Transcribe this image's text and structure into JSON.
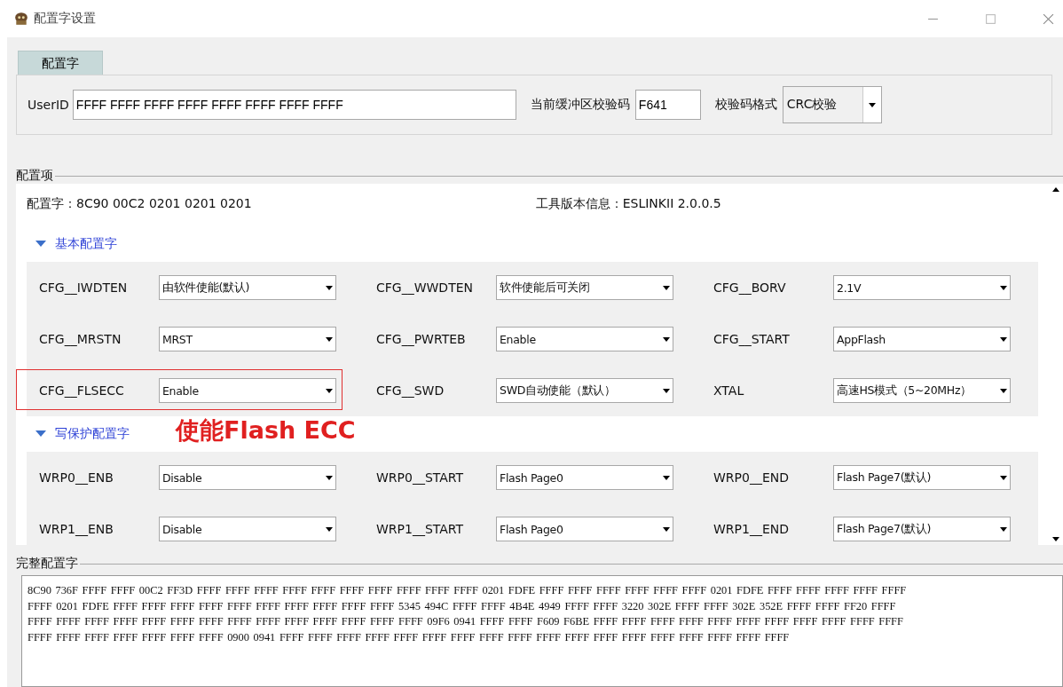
{
  "window": {
    "title": "配置字设置"
  },
  "tabs": [
    {
      "label": "配置字",
      "selected": true
    }
  ],
  "userid": {
    "label": "UserID",
    "value": "FFFF FFFF FFFF FFFF FFFF FFFF FFFF FFFF"
  },
  "checksum": {
    "label": "当前缓冲区校验码",
    "value": "F641"
  },
  "checksum_format": {
    "label": "校验码格式",
    "value": "CRC校验"
  },
  "config_group": {
    "title": "配置项",
    "config_word": "配置字：8C90 00C2 0201 0201 0201",
    "tool_version": "工具版本信息：ESLINKII 2.0.0.5",
    "sections": [
      {
        "title": "基本配置字",
        "expanded": true,
        "fields": [
          {
            "label": "CFG__IWDTEN",
            "value": "由软件使能(默认)",
            "highlighted": false
          },
          {
            "label": "CFG__WWDTEN",
            "value": "软件使能后可关闭",
            "highlighted": false
          },
          {
            "label": "CFG__BORV",
            "value": "2.1V",
            "highlighted": false
          },
          {
            "label": "CFG__MRSTN",
            "value": "MRST",
            "highlighted": false
          },
          {
            "label": "CFG__PWRTEB",
            "value": "Enable",
            "highlighted": false
          },
          {
            "label": "CFG__START",
            "value": "AppFlash",
            "highlighted": false
          },
          {
            "label": "CFG__FLSECC",
            "value": "Enable",
            "highlighted": true
          },
          {
            "label": "CFG__SWD",
            "value": "SWD自动使能（默认）",
            "highlighted": false
          },
          {
            "label": "XTAL",
            "value": "高速HS模式（5~20MHz）",
            "highlighted": false
          }
        ]
      },
      {
        "title": "写保护配置字",
        "expanded": true,
        "fields": [
          {
            "label": "WRP0__ENB",
            "value": "Disable",
            "highlighted": false
          },
          {
            "label": "WRP0__START",
            "value": "Flash Page0",
            "highlighted": false
          },
          {
            "label": "WRP0__END",
            "value": "Flash Page7(默认)",
            "highlighted": false
          },
          {
            "label": "WRP1__ENB",
            "value": "Disable",
            "highlighted": false
          },
          {
            "label": "WRP1__START",
            "value": "Flash Page0",
            "highlighted": false
          },
          {
            "label": "WRP1__END",
            "value": "Flash Page7(默认)",
            "highlighted": false
          }
        ]
      }
    ]
  },
  "annotation": {
    "text": "使能Flash ECC"
  },
  "full_config": {
    "title": "完整配置字",
    "lines": [
      "8C90 736F FFFF FFFF 00C2 FF3D FFFF FFFF FFFF FFFF FFFF FFFF FFFF FFFF FFFF FFFF 0201 FDFE FFFF FFFF FFFF FFFF FFFF FFFF 0201 FDFE FFFF FFFF FFFF FFFF FFFF",
      "FFFF 0201 FDFE FFFF FFFF FFFF FFFF FFFF FFFF FFFF FFFF FFFF FFFF 5345 494C FFFF FFFF 4B4E 4949 FFFF FFFF 3220 302E FFFF FFFF 302E 352E FFFF FFFF FF20 FFFF",
      "FFFF FFFF FFFF FFFF FFFF FFFF FFFF FFFF FFFF FFFF FFFF FFFF FFFF FFFF 09F6 0941 FFFF FFFF F609 F6BE FFFF FFFF FFFF FFFF FFFF FFFF FFFF FFFF FFFF FFFF FFFF",
      "FFFF FFFF FFFF FFFF FFFF FFFF FFFF 0900 0941 FFFF FFFF FFFF FFFF FFFF FFFF FFFF FFFF FFFF FFFF FFFF FFFF FFFF FFFF FFFF FFFF FFFF FFFF"
    ]
  }
}
